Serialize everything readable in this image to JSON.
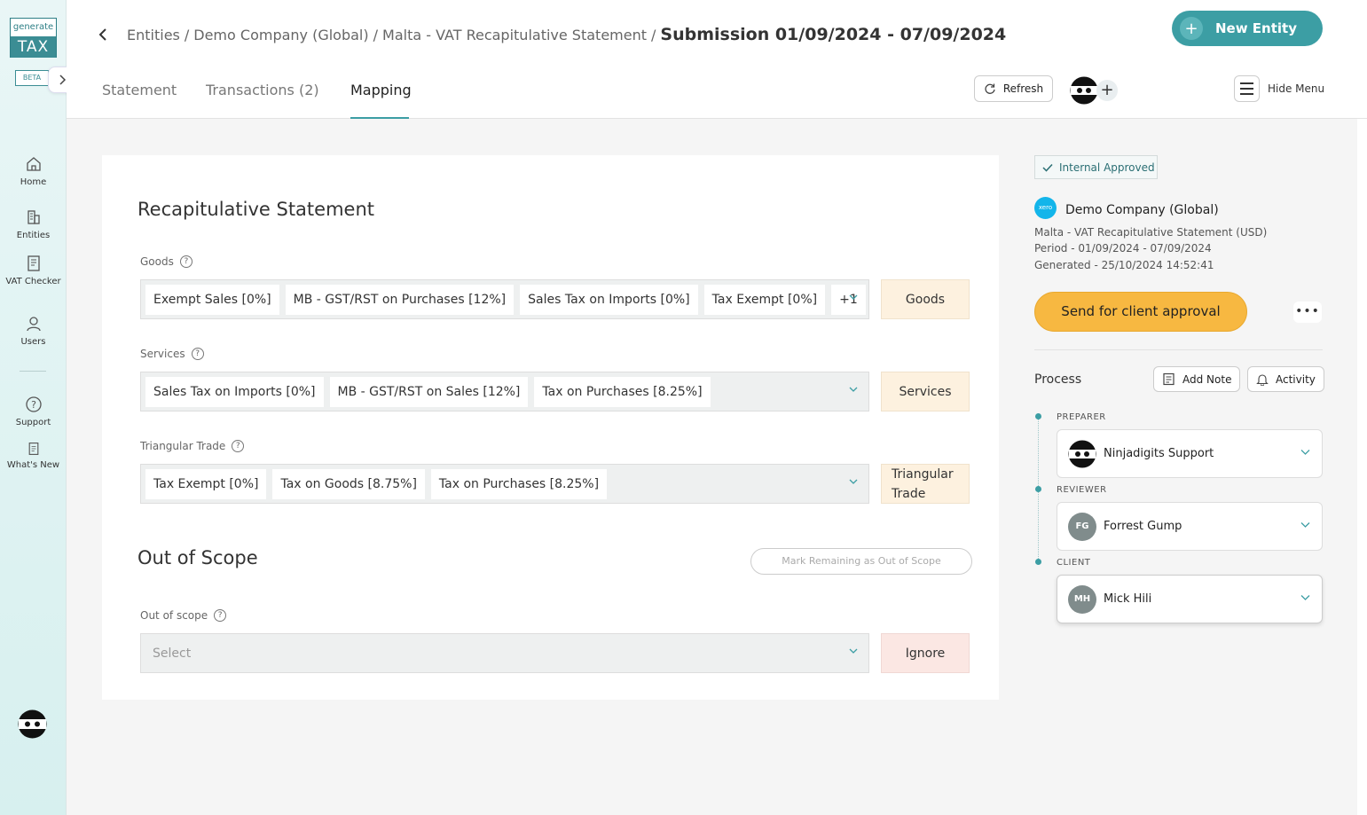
{
  "sidebar": {
    "logo_top": "generate",
    "logo_bottom": "TAX",
    "beta": "BETA",
    "items": [
      {
        "label": "Home"
      },
      {
        "label": "Entities"
      },
      {
        "label": "VAT Checker"
      },
      {
        "label": "Users"
      },
      {
        "label": "Support"
      },
      {
        "label": "What's New"
      }
    ]
  },
  "header": {
    "breadcrumbs": [
      "Entities",
      "Demo Company (Global)",
      "Malta - VAT Recapitulative Statement"
    ],
    "separator": "/",
    "current": "Submission 01/09/2024 - 07/09/2024",
    "new_entity": "New Entity",
    "tabs": [
      {
        "label": "Statement",
        "active": false
      },
      {
        "label": "Transactions (2)",
        "active": false
      },
      {
        "label": "Mapping",
        "active": true
      }
    ],
    "refresh": "Refresh",
    "hide_menu": "Hide Menu"
  },
  "main": {
    "title": "Recapitulative Statement",
    "fields": [
      {
        "label": "Goods",
        "chips": [
          "Exempt Sales [0%]",
          "MB - GST/RST on Purchases [12%]",
          "Sales Tax on Imports [0%]",
          "Tax Exempt [0%]",
          "+1"
        ],
        "box": "Goods"
      },
      {
        "label": "Services",
        "chips": [
          "Sales Tax on Imports [0%]",
          "MB - GST/RST on Sales [12%]",
          "Tax on Purchases [8.25%]"
        ],
        "box": "Services"
      },
      {
        "label": "Triangular Trade",
        "chips": [
          "Tax Exempt [0%]",
          "Tax on Goods [8.75%]",
          "Tax on Purchases [8.25%]"
        ],
        "box_line1": "Triangular",
        "box_line2": "Trade"
      }
    ],
    "oos_title": "Out of Scope",
    "mark_remaining": "Mark Remaining as Out of Scope",
    "oos_label": "Out of scope",
    "oos_placeholder": "Select",
    "ignore": "Ignore"
  },
  "panel": {
    "status": "Internal Approved",
    "xero": "xero",
    "company": "Demo Company (Global)",
    "statement": "Malta - VAT Recapitulative Statement (USD)",
    "period": "Period - 01/09/2024 - 07/09/2024",
    "generated": "Generated - 25/10/2024 14:52:41",
    "send": "Send for client approval",
    "more": "•••",
    "process": "Process",
    "add_note": "Add Note",
    "activity": "Activity",
    "roles": [
      {
        "role": "PREPARER",
        "name": "Ninjadigits Support",
        "initials": ""
      },
      {
        "role": "REVIEWER",
        "name": "Forrest Gump",
        "initials": "FG"
      },
      {
        "role": "CLIENT",
        "name": "Mick Hili",
        "initials": "MH"
      }
    ]
  },
  "colors": {
    "accent": "#3c9ea4",
    "send_button": "#f7b841",
    "box_warm": "#fdf1df",
    "box_ignore": "#fbe7e3"
  }
}
